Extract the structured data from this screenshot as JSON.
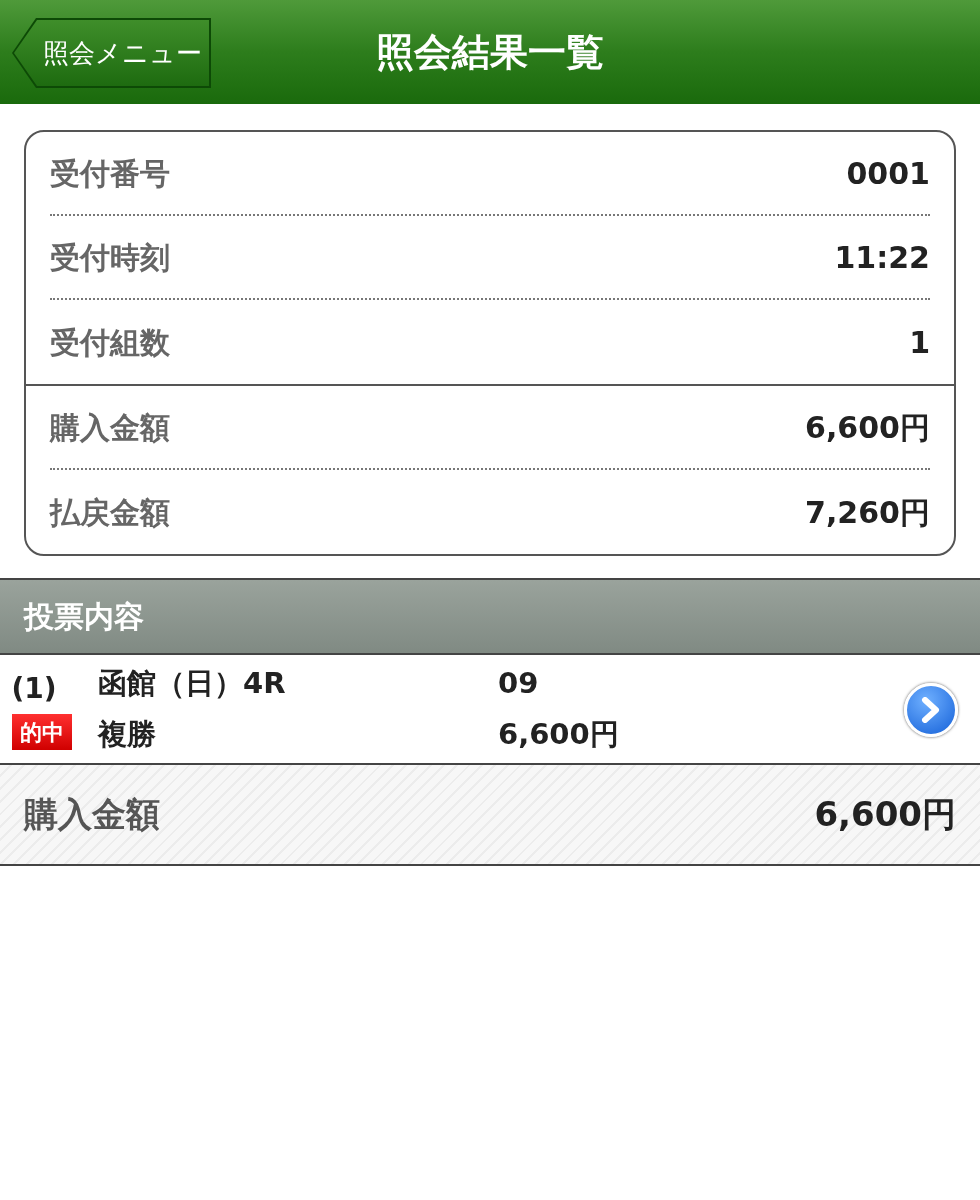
{
  "header": {
    "back_button": "照会メニュー",
    "title": "照会結果一覧"
  },
  "summary": {
    "groups": [
      [
        {
          "label": "受付番号",
          "value": "0001"
        },
        {
          "label": "受付時刻",
          "value": "11:22"
        },
        {
          "label": "受付組数",
          "value": "1"
        }
      ],
      [
        {
          "label": "購入金額",
          "value": "6,600円"
        },
        {
          "label": "払戻金額",
          "value": "7,260円"
        }
      ]
    ]
  },
  "section_title": "投票内容",
  "bets": [
    {
      "number": "(1)",
      "badge": "的中",
      "race": "函館（日）4R",
      "selection": "09",
      "bet_type": "複勝",
      "amount": "6,600円"
    }
  ],
  "total": {
    "label": "購入金額",
    "value": "6,600円"
  }
}
